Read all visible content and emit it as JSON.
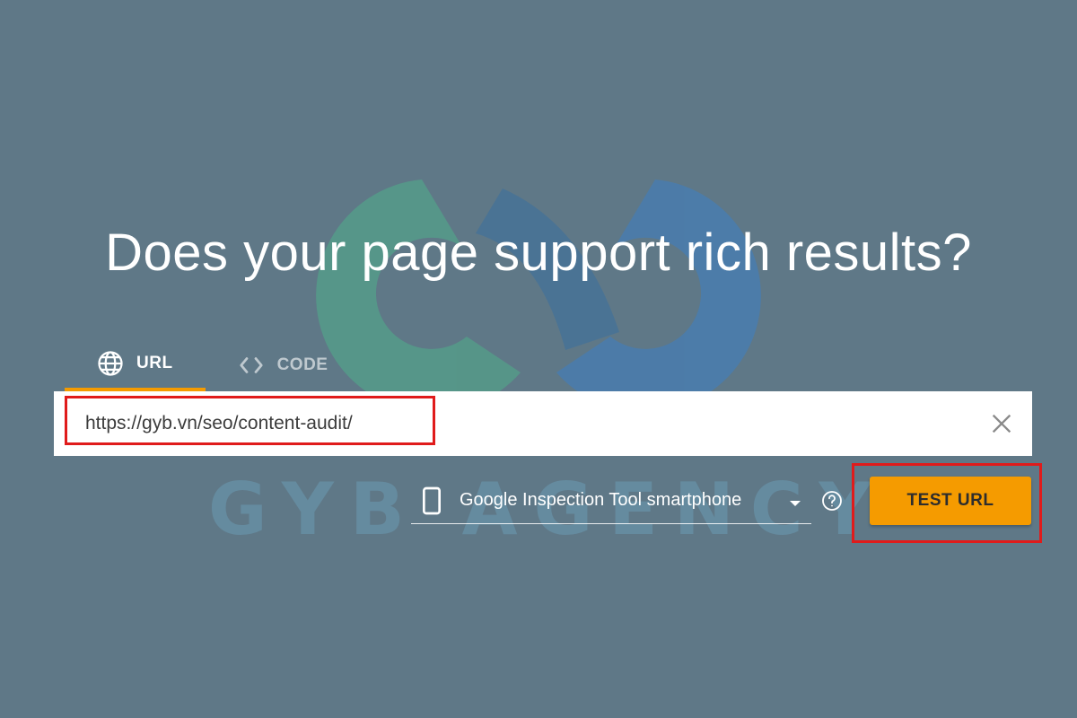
{
  "title": "Does your page support rich results?",
  "tabs": [
    {
      "label": "URL",
      "icon": "globe-icon",
      "active": true
    },
    {
      "label": "CODE",
      "icon": "code-brackets-icon",
      "active": false
    }
  ],
  "url_input": {
    "value": "https://gyb.vn/seo/content-audit/"
  },
  "device_select": {
    "selected": "Google Inspection Tool smartphone",
    "icon": "smartphone-icon"
  },
  "test_button": {
    "label": "TEST URL"
  },
  "watermark": {
    "text": "GYB AGENCY"
  },
  "colors": {
    "background": "#5f7887",
    "accent": "#f59b00",
    "highlight": "#e01b1b"
  }
}
